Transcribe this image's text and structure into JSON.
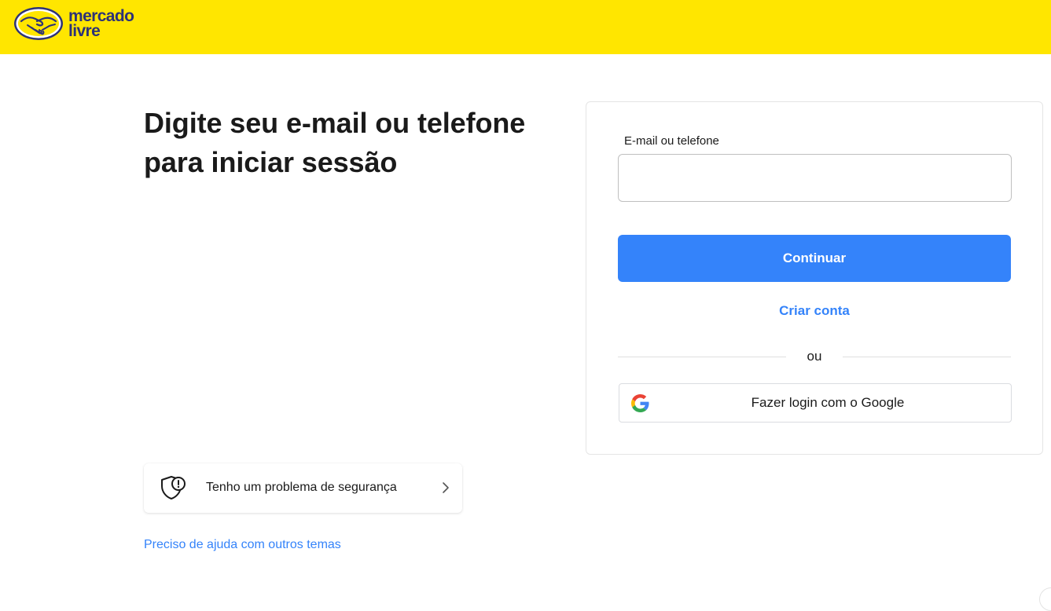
{
  "header": {
    "brand_line1": "mercado",
    "brand_line2": "livre",
    "accent_color": "#ffe600",
    "logo_icon": "handshake-icon"
  },
  "main": {
    "title": "Digite seu e-mail ou telefone para iniciar sessão"
  },
  "login_form": {
    "field_label": "E-mail ou telefone",
    "field_value": "",
    "continue_label": "Continuar",
    "create_account_label": "Criar conta",
    "divider_label": "ou",
    "google_label": "Fazer login com o Google",
    "google_icon": "google-icon",
    "primary_color": "#3483fa"
  },
  "security": {
    "label": "Tenho um problema de segurança",
    "icon": "shield-alert-icon",
    "chevron_icon": "chevron-right-icon"
  },
  "help": {
    "label": "Preciso de ajuda com outros temas"
  }
}
